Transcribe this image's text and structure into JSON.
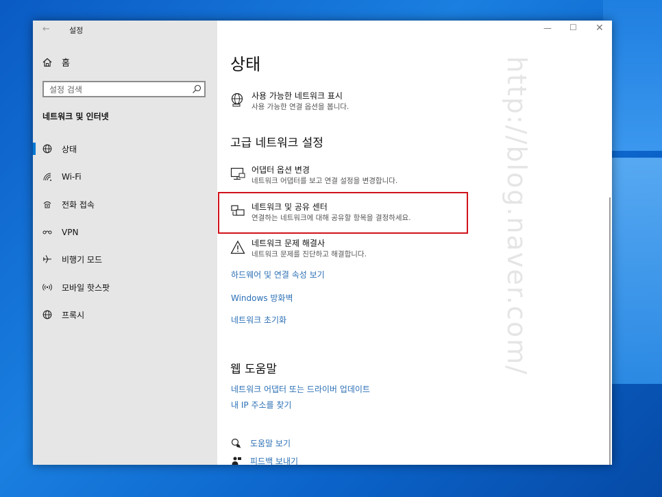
{
  "window": {
    "title": "설정",
    "controls": [
      "minimize-icon",
      "maximize-icon",
      "close-icon"
    ]
  },
  "sidebar": {
    "home_label": "홈",
    "search_placeholder": "설정 검색",
    "section_title": "네트워크 및 인터넷",
    "items": [
      {
        "label": "상태",
        "icon": "globe-status-icon",
        "active": true
      },
      {
        "label": "Wi-Fi",
        "icon": "wifi-icon",
        "active": false
      },
      {
        "label": "전화 접속",
        "icon": "dialup-icon",
        "active": false
      },
      {
        "label": "VPN",
        "icon": "vpn-icon",
        "active": false
      },
      {
        "label": "비행기 모드",
        "icon": "airplane-icon",
        "active": false
      },
      {
        "label": "모바일 핫스팟",
        "icon": "hotspot-icon",
        "active": false
      },
      {
        "label": "프록시",
        "icon": "globe-icon",
        "active": false
      }
    ]
  },
  "main": {
    "title": "상태",
    "show_networks": {
      "title": "사용 가능한 네트워크 표시",
      "desc": "사용 가능한 연결 옵션을 봅니다."
    },
    "advanced_title": "고급 네트워크 설정",
    "options": [
      {
        "title": "어댑터 옵션 변경",
        "desc": "네트워크 어댑터를 보고 연결 설정을 변경합니다.",
        "icon": "adapter-icon"
      },
      {
        "title": "네트워크 및 공유 센터",
        "desc": "연결하는 네트워크에 대해 공유할 항목을 결정하세요.",
        "icon": "sharing-center-icon"
      },
      {
        "title": "네트워크 문제 해결사",
        "desc": "네트워크 문제를 진단하고 해결합니다.",
        "icon": "warning-icon"
      }
    ],
    "links": [
      "하드웨어 및 연결 속성 보기",
      "Windows 방화벽",
      "네트워크 초기화"
    ],
    "web_help_title": "웹 도움말",
    "web_help_links": [
      "네트워크 어댑터 또는 드라이버 업데이트",
      "내 IP 주소를 찾기"
    ],
    "help_items": [
      {
        "label": "도움말 보기",
        "icon": "help-chat-icon"
      },
      {
        "label": "피드백 보내기",
        "icon": "feedback-icon"
      }
    ],
    "watermark": "http://blog.naver.com/"
  },
  "colors": {
    "accent": "#0078d4",
    "link": "#2b6fb5",
    "highlight": "#d0121b"
  }
}
